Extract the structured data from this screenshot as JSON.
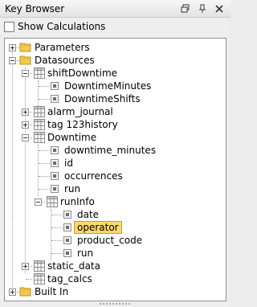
{
  "window": {
    "title": "Key Browser"
  },
  "options": {
    "show_calculations_label": "Show Calculations",
    "show_calculations_checked": false
  },
  "tree": {
    "parameters": "Parameters",
    "datasources": "Datasources",
    "shiftDowntime": "shiftDowntime",
    "downtimeMinutes": "DowntimeMinutes",
    "downtimeShifts": "DowntimeShifts",
    "alarm_journal": "alarm_journal",
    "tag123history": "tag 123history",
    "downtime": "Downtime",
    "downtime_minutes": "downtime_minutes",
    "id": "id",
    "occurrences": "occurrences",
    "run": "run",
    "runInfo": "runInfo",
    "date": "date",
    "operator": "operator",
    "product_code": "product_code",
    "run2": "run",
    "static_data": "static_data",
    "tag_calcs": "tag_calcs",
    "built_in": "Built In"
  }
}
